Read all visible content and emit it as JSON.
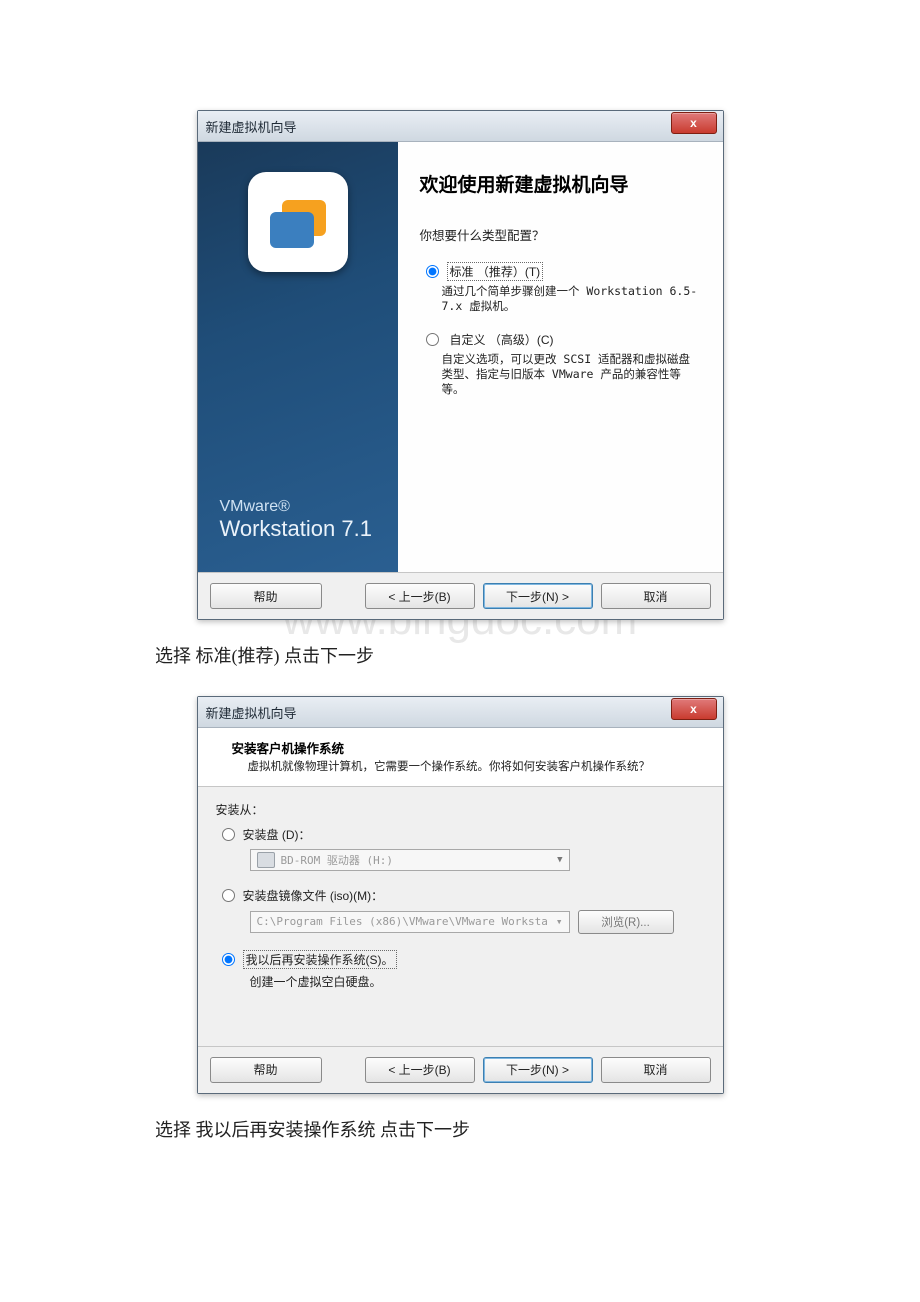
{
  "watermark": "www.bingdoc.com",
  "dialog1": {
    "title": "新建虚拟机向导",
    "close_label": "x",
    "brand_line1": "VMware®",
    "brand_line2": "Workstation 7.1",
    "heading": "欢迎使用新建虚拟机向导",
    "prompt": "你想要什么类型配置？",
    "opt1": {
      "label": "标准 （推荐）(T)",
      "desc": "通过几个简单步骤创建一个 Workstation 6.5-7.x 虚拟机。"
    },
    "opt2": {
      "label": "自定义 （高级）(C)",
      "desc": "自定义选项，可以更改 SCSI 适配器和虚拟磁盘类型、指定与旧版本 VMware 产品的兼容性等等。"
    },
    "btn_help": "帮助",
    "btn_back": "< 上一步(B)",
    "btn_next": "下一步(N) >",
    "btn_cancel": "取消"
  },
  "caption1": "选择 标准(推荐) 点击下一步",
  "dialog2": {
    "title": "新建虚拟机向导",
    "close_label": "x",
    "head_title": "安装客户机操作系统",
    "head_desc": "虚拟机就像物理计算机，它需要一个操作系统。你将如何安装客户机操作系统？",
    "install_from": "安装从：",
    "opt_disc": {
      "label": "安装盘 (D)：",
      "drive": "BD-ROM 驱动器 (H:)"
    },
    "opt_iso": {
      "label": "安装盘镜像文件 (iso)(M)：",
      "path": "C:\\Program Files (x86)\\VMware\\VMware Worksta",
      "browse": "浏览(R)..."
    },
    "opt_later": {
      "label": "我以后再安装操作系统(S)。",
      "desc": "创建一个虚拟空白硬盘。"
    },
    "btn_help": "帮助",
    "btn_back": "< 上一步(B)",
    "btn_next": "下一步(N) >",
    "btn_cancel": "取消"
  },
  "caption2": "选择 我以后再安装操作系统 点击下一步"
}
